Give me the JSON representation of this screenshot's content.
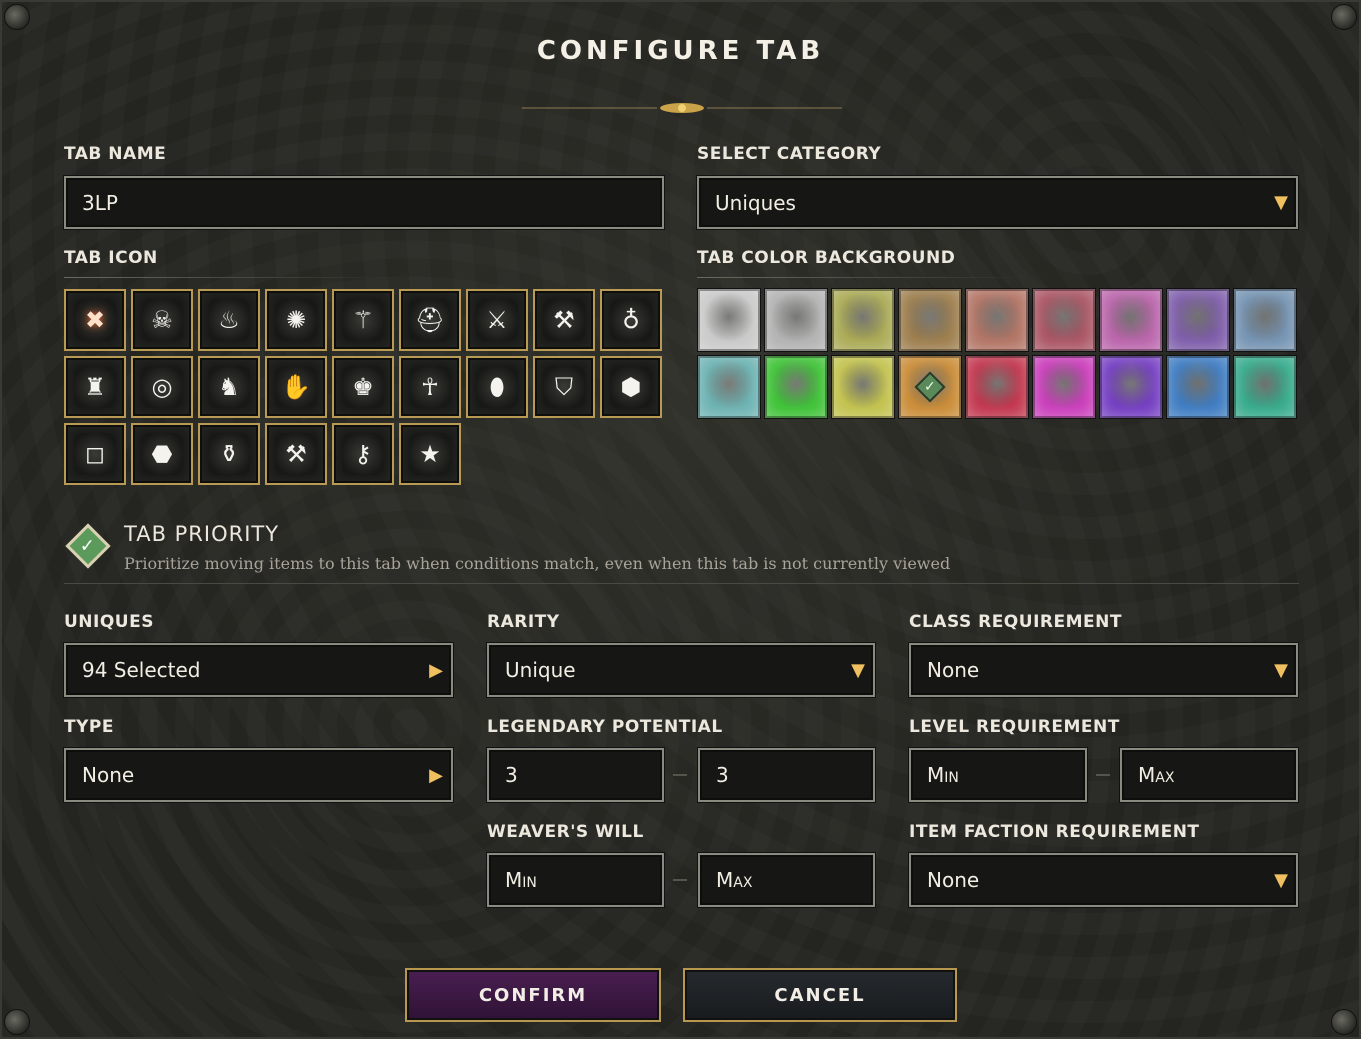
{
  "dialog": {
    "title": "CONFIGURE TAB"
  },
  "tab_name": {
    "label": "TAB NAME",
    "value": "3LP"
  },
  "select_category": {
    "label": "SELECT CATEGORY",
    "value": "Uniques"
  },
  "tab_icon": {
    "label": "TAB ICON",
    "icons": [
      {
        "name": "cross-icon",
        "glyph": "✖"
      },
      {
        "name": "skull-icon",
        "glyph": "☠"
      },
      {
        "name": "flame-icon",
        "glyph": "♨"
      },
      {
        "name": "burst-icon",
        "glyph": "✺"
      },
      {
        "name": "figures-icon",
        "glyph": "⚚"
      },
      {
        "name": "helm-icon",
        "glyph": "⛑"
      },
      {
        "name": "sword-icon",
        "glyph": "⚔"
      },
      {
        "name": "axe-icon",
        "glyph": "⚒"
      },
      {
        "name": "bag-icon",
        "glyph": "♁"
      },
      {
        "name": "armor-icon",
        "glyph": "♜"
      },
      {
        "name": "ring-icon",
        "glyph": "◎"
      },
      {
        "name": "boots-icon",
        "glyph": "♞"
      },
      {
        "name": "gloves-icon",
        "glyph": "✋"
      },
      {
        "name": "helmet-icon",
        "glyph": "♚"
      },
      {
        "name": "amulet-icon",
        "glyph": "☥"
      },
      {
        "name": "relic-icon",
        "glyph": "⬮"
      },
      {
        "name": "shield-icon",
        "glyph": "⛉"
      },
      {
        "name": "rune-icon",
        "glyph": "⬢"
      },
      {
        "name": "square-icon",
        "glyph": "◻"
      },
      {
        "name": "gem-icon",
        "glyph": "⬣"
      },
      {
        "name": "potions-icon",
        "glyph": "⚱"
      },
      {
        "name": "anvil-icon",
        "glyph": "⚒"
      },
      {
        "name": "key-icon",
        "glyph": "⚷"
      },
      {
        "name": "star-icon",
        "glyph": "★"
      }
    ]
  },
  "tab_color": {
    "label": "TAB COLOR BACKGROUND",
    "colors": [
      "#c8c8c8",
      "#b0b0b0",
      "#a8a850",
      "#9a7a48",
      "#b07060",
      "#a85060",
      "#b860a8",
      "#7a58a8",
      "#7090b0",
      "#68b0b0",
      "#38c030",
      "#c0c048",
      "#c88830",
      "#c03048",
      "#c838b8",
      "#7038c0",
      "#3878c0",
      "#30a888"
    ],
    "selected_index": 12
  },
  "tab_priority": {
    "title": "TAB PRIORITY",
    "description": "Prioritize moving items to this tab when conditions match, even when this tab is not currently viewed"
  },
  "filters": {
    "uniques": {
      "label": "UNIQUES",
      "value": "94 Selected"
    },
    "rarity": {
      "label": "RARITY",
      "value": "Unique"
    },
    "class_requirement": {
      "label": "CLASS REQUIREMENT",
      "value": "None"
    },
    "type": {
      "label": "TYPE",
      "value": "None"
    },
    "legendary_potential": {
      "label": "LEGENDARY POTENTIAL",
      "min": "3",
      "max": "3"
    },
    "level_requirement": {
      "label": "LEVEL REQUIREMENT",
      "min": "Min",
      "max": "Max"
    },
    "weavers_will": {
      "label": "WEAVER'S WILL",
      "min": "Min",
      "max": "Max"
    },
    "item_faction_requirement": {
      "label": "ITEM FACTION REQUIREMENT",
      "value": "None"
    }
  },
  "buttons": {
    "confirm": "CONFIRM",
    "cancel": "CANCEL"
  }
}
